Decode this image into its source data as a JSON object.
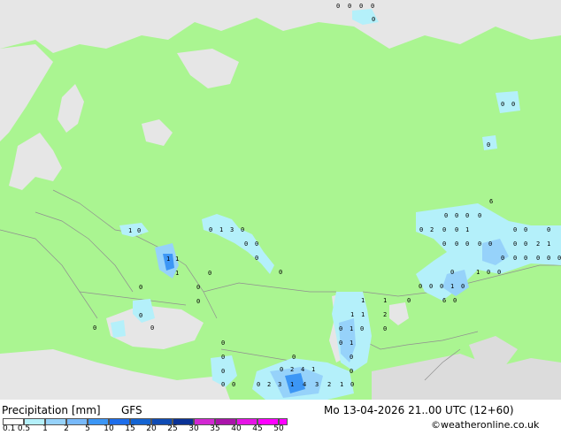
{
  "title": "Precipitation [mm]",
  "model": "GFS",
  "valid_time": "Mo 13-04-2026 21..00 UTC (12+60)",
  "copyright": "©weatheronline.co.uk",
  "legend": {
    "ticks": [
      "0.1",
      "0.5",
      "1",
      "2",
      "5",
      "10",
      "15",
      "20",
      "25",
      "30",
      "35",
      "40",
      "45",
      "50"
    ],
    "colors": [
      "#ffffff",
      "#b4f0fa",
      "#96d2fa",
      "#78b9fa",
      "#3c96f5",
      "#1e6eeb",
      "#1464d2",
      "#0f4bb4",
      "#0a3296",
      "#d228d2",
      "#aa14aa",
      "#e614e6",
      "#ff00ff",
      "#ff00ff"
    ]
  },
  "map_colors": {
    "land": "#aaf591",
    "sea": "#e6e6e6",
    "precip_light": "#b4f0fa",
    "precip_med": "#96d2fa",
    "precip_heavy": "#3c96f5",
    "border": "#909090"
  },
  "grid_values": [
    {
      "id": "v1",
      "text": "0"
    },
    {
      "id": "v2",
      "text": "0"
    },
    {
      "id": "v3",
      "text": "0"
    },
    {
      "id": "v4",
      "text": "0"
    },
    {
      "id": "v5",
      "text": "0"
    },
    {
      "id": "v6",
      "text": "0"
    },
    {
      "id": "v7",
      "text": "0"
    },
    {
      "id": "v8",
      "text": "1"
    },
    {
      "id": "v9",
      "text": "0"
    },
    {
      "id": "v10",
      "text": "1"
    },
    {
      "id": "v11",
      "text": "3"
    },
    {
      "id": "v12",
      "text": "0"
    },
    {
      "id": "v13",
      "text": "0"
    },
    {
      "id": "v14",
      "text": "0"
    },
    {
      "id": "v15",
      "text": "0"
    },
    {
      "id": "v16",
      "text": "0"
    },
    {
      "id": "v17",
      "text": "1"
    },
    {
      "id": "v18",
      "text": "1"
    },
    {
      "id": "v19",
      "text": "0"
    },
    {
      "id": "v20",
      "text": "0"
    },
    {
      "id": "v21",
      "text": "0"
    },
    {
      "id": "v22",
      "text": "0"
    },
    {
      "id": "v23",
      "text": "0"
    },
    {
      "id": "v24",
      "text": "0"
    },
    {
      "id": "v25",
      "text": "1"
    },
    {
      "id": "v26",
      "text": "0"
    },
    {
      "id": "v27",
      "text": "2"
    },
    {
      "id": "v28",
      "text": "1"
    },
    {
      "id": "v29",
      "text": "2"
    },
    {
      "id": "v30",
      "text": "1"
    },
    {
      "id": "v31",
      "text": "0"
    },
    {
      "id": "v32",
      "text": "2"
    },
    {
      "id": "v33",
      "text": "1"
    },
    {
      "id": "v34",
      "text": "0"
    },
    {
      "id": "v35",
      "text": "0"
    },
    {
      "id": "v36",
      "text": "4"
    },
    {
      "id": "v37",
      "text": "3"
    },
    {
      "id": "v38",
      "text": "2"
    },
    {
      "id": "v39",
      "text": "1"
    },
    {
      "id": "v40",
      "text": "6"
    }
  ]
}
